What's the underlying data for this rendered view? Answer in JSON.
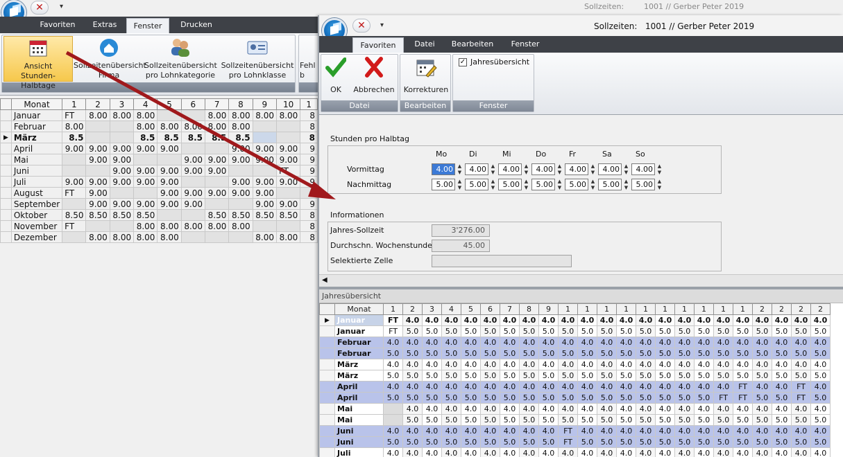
{
  "bg_window": {
    "title_label": "Sollzeiten:",
    "title_value": "1001 // Gerber Peter 2019",
    "tabs": [
      "Favoriten",
      "Extras",
      "Fenster",
      "Drucken"
    ],
    "active_tab": "Fenster",
    "ribbon_buttons": [
      {
        "icon": "calendar-icon",
        "label1": "Ansicht",
        "label2": "Stunden-Halbtage"
      },
      {
        "icon": "home-icon",
        "label1": "Sollzeitenübersicht",
        "label2": "Firma"
      },
      {
        "icon": "users-icon",
        "label1": "Sollzeitenübersicht",
        "label2": "pro Lohnkategorie"
      },
      {
        "icon": "id-card-icon",
        "label1": "Sollzeitenübersicht",
        "label2": "pro Lohnklasse"
      },
      {
        "icon": "cut-icon",
        "label1": "Fehl",
        "label2": "b"
      }
    ],
    "grid": {
      "headers": [
        "Monat",
        "1",
        "2",
        "3",
        "4",
        "5",
        "6",
        "7",
        "8",
        "9",
        "10",
        "1"
      ],
      "rows": [
        {
          "month": "Januar",
          "cells": [
            "FT",
            "8.00",
            "8.00",
            "8.00",
            "",
            "",
            "8.00",
            "8.00",
            "8.00",
            "8.00",
            "8"
          ]
        },
        {
          "month": "Februar",
          "cells": [
            "8.00",
            "",
            "",
            "8.00",
            "8.00",
            "8.00",
            "8.00",
            "8.00",
            "",
            "",
            "8"
          ]
        },
        {
          "month": "März",
          "cells": [
            "8.5",
            "",
            "",
            "8.5",
            "8.5",
            "8.5",
            "8.5",
            "8.5",
            "",
            "",
            "8"
          ]
        },
        {
          "month": "April",
          "cells": [
            "9.00",
            "9.00",
            "9.00",
            "9.00",
            "9.00",
            "",
            "",
            "9.00",
            "9.00",
            "9.00",
            "9"
          ]
        },
        {
          "month": "Mai",
          "cells": [
            "",
            "9.00",
            "9.00",
            "",
            "",
            "9.00",
            "9.00",
            "9.00",
            "9.00",
            "9.00",
            "9"
          ]
        },
        {
          "month": "Juni",
          "cells": [
            "",
            "",
            "9.00",
            "9.00",
            "9.00",
            "9.00",
            "9.00",
            "",
            "",
            "FT",
            "9"
          ]
        },
        {
          "month": "Juli",
          "cells": [
            "9.00",
            "9.00",
            "9.00",
            "9.00",
            "9.00",
            "",
            "",
            "9.00",
            "9.00",
            "9.00",
            "9"
          ]
        },
        {
          "month": "August",
          "cells": [
            "FT",
            "9.00",
            "",
            "",
            "9.00",
            "9.00",
            "9.00",
            "9.00",
            "9.00",
            "",
            ""
          ]
        },
        {
          "month": "September",
          "cells": [
            "",
            "9.00",
            "9.00",
            "9.00",
            "9.00",
            "9.00",
            "",
            "",
            "9.00",
            "9.00",
            "9"
          ]
        },
        {
          "month": "Oktober",
          "cells": [
            "8.50",
            "8.50",
            "8.50",
            "8.50",
            "",
            "",
            "8.50",
            "8.50",
            "8.50",
            "8.50",
            "8"
          ]
        },
        {
          "month": "November",
          "cells": [
            "FT",
            "",
            "",
            "8.00",
            "8.00",
            "8.00",
            "8.00",
            "8.00",
            "",
            "",
            "8"
          ]
        },
        {
          "month": "Dezember",
          "cells": [
            "",
            "8.00",
            "8.00",
            "8.00",
            "8.00",
            "",
            "",
            "",
            "8.00",
            "8.00",
            "8"
          ]
        }
      ]
    }
  },
  "fg_window": {
    "title_label": "Sollzeiten:",
    "title_value": "1001 // Gerber Peter 2019",
    "tabs": [
      "Favoriten",
      "Datei",
      "Bearbeiten",
      "Fenster"
    ],
    "active_tab": "Favoriten",
    "ribbon": {
      "ok": "OK",
      "cancel": "Abbrechen",
      "corrections": "Korrekturen",
      "year_overview_checkbox": "Jahresübersicht",
      "group_datei": "Datei",
      "group_bearbeiten": "Bearbeiten",
      "group_fenster": "Fenster"
    },
    "hours": {
      "title": "Stunden pro Halbtag",
      "days": [
        "Mo",
        "Di",
        "Mi",
        "Do",
        "Fr",
        "Sa",
        "So"
      ],
      "morning_label": "Vormittag",
      "afternoon_label": "Nachmittag",
      "morning": [
        "4.00",
        "4.00",
        "4.00",
        "4.00",
        "4.00",
        "4.00",
        "4.00"
      ],
      "afternoon": [
        "5.00",
        "5.00",
        "5.00",
        "5.00",
        "5.00",
        "5.00",
        "5.00"
      ]
    },
    "info": {
      "title": "Informationen",
      "annual_label": "Jahres-Sollzeit",
      "annual_value": "3'276.00",
      "weekly_label": "Durchschn. Wochenstunden",
      "weekly_value": "45.00",
      "selected_label": "Selektierte Zelle",
      "selected_value": ""
    },
    "overview": {
      "title": "Jahresübersicht",
      "month_header": "Monat",
      "col_headers": [
        "1",
        "2",
        "3",
        "4",
        "5",
        "6",
        "7",
        "8",
        "9",
        "1",
        "1",
        "1",
        "1",
        "1",
        "1",
        "1",
        "1",
        "1",
        "1",
        "2",
        "2",
        "2",
        "2"
      ],
      "rows": [
        {
          "month": "Januar",
          "blue": false,
          "hdr": true,
          "cells": [
            "FT",
            "4.0",
            "4.0",
            "4.0",
            "4.0",
            "4.0",
            "4.0",
            "4.0",
            "4.0",
            "4.0",
            "4.0",
            "4.0",
            "4.0",
            "4.0",
            "4.0",
            "4.0",
            "4.0",
            "4.0",
            "4.0",
            "4.0",
            "4.0",
            "4.0",
            "4.0"
          ]
        },
        {
          "month": "Januar",
          "blue": false,
          "hdr": false,
          "cells": [
            "FT",
            "5.0",
            "5.0",
            "5.0",
            "5.0",
            "5.0",
            "5.0",
            "5.0",
            "5.0",
            "5.0",
            "5.0",
            "5.0",
            "5.0",
            "5.0",
            "5.0",
            "5.0",
            "5.0",
            "5.0",
            "5.0",
            "5.0",
            "5.0",
            "5.0",
            "5.0"
          ]
        },
        {
          "month": "Februar",
          "blue": true,
          "hdr": false,
          "cells": [
            "4.0",
            "4.0",
            "4.0",
            "4.0",
            "4.0",
            "4.0",
            "4.0",
            "4.0",
            "4.0",
            "4.0",
            "4.0",
            "4.0",
            "4.0",
            "4.0",
            "4.0",
            "4.0",
            "4.0",
            "4.0",
            "4.0",
            "4.0",
            "4.0",
            "4.0",
            "4.0"
          ]
        },
        {
          "month": "Februar",
          "blue": true,
          "hdr": false,
          "cells": [
            "5.0",
            "5.0",
            "5.0",
            "5.0",
            "5.0",
            "5.0",
            "5.0",
            "5.0",
            "5.0",
            "5.0",
            "5.0",
            "5.0",
            "5.0",
            "5.0",
            "5.0",
            "5.0",
            "5.0",
            "5.0",
            "5.0",
            "5.0",
            "5.0",
            "5.0",
            "5.0"
          ]
        },
        {
          "month": "März",
          "blue": false,
          "hdr": false,
          "cells": [
            "4.0",
            "4.0",
            "4.0",
            "4.0",
            "4.0",
            "4.0",
            "4.0",
            "4.0",
            "4.0",
            "4.0",
            "4.0",
            "4.0",
            "4.0",
            "4.0",
            "4.0",
            "4.0",
            "4.0",
            "4.0",
            "4.0",
            "4.0",
            "4.0",
            "4.0",
            "4.0"
          ]
        },
        {
          "month": "März",
          "blue": false,
          "hdr": false,
          "cells": [
            "5.0",
            "5.0",
            "5.0",
            "5.0",
            "5.0",
            "5.0",
            "5.0",
            "5.0",
            "5.0",
            "5.0",
            "5.0",
            "5.0",
            "5.0",
            "5.0",
            "5.0",
            "5.0",
            "5.0",
            "5.0",
            "5.0",
            "5.0",
            "5.0",
            "5.0",
            "5.0"
          ]
        },
        {
          "month": "April",
          "blue": true,
          "hdr": false,
          "cells": [
            "4.0",
            "4.0",
            "4.0",
            "4.0",
            "4.0",
            "4.0",
            "4.0",
            "4.0",
            "4.0",
            "4.0",
            "4.0",
            "4.0",
            "4.0",
            "4.0",
            "4.0",
            "4.0",
            "4.0",
            "4.0",
            "FT",
            "4.0",
            "4.0",
            "FT",
            "4.0"
          ]
        },
        {
          "month": "April",
          "blue": true,
          "hdr": false,
          "cells": [
            "5.0",
            "5.0",
            "5.0",
            "5.0",
            "5.0",
            "5.0",
            "5.0",
            "5.0",
            "5.0",
            "5.0",
            "5.0",
            "5.0",
            "5.0",
            "5.0",
            "5.0",
            "5.0",
            "5.0",
            "FT",
            "FT",
            "5.0",
            "5.0",
            "FT",
            "5.0"
          ]
        },
        {
          "month": "Mai",
          "blue": false,
          "hdr": false,
          "cells": [
            "",
            "4.0",
            "4.0",
            "4.0",
            "4.0",
            "4.0",
            "4.0",
            "4.0",
            "4.0",
            "4.0",
            "4.0",
            "4.0",
            "4.0",
            "4.0",
            "4.0",
            "4.0",
            "4.0",
            "4.0",
            "4.0",
            "4.0",
            "4.0",
            "4.0",
            "4.0"
          ]
        },
        {
          "month": "Mai",
          "blue": false,
          "hdr": false,
          "cells": [
            "",
            "5.0",
            "5.0",
            "5.0",
            "5.0",
            "5.0",
            "5.0",
            "5.0",
            "5.0",
            "5.0",
            "5.0",
            "5.0",
            "5.0",
            "5.0",
            "5.0",
            "5.0",
            "5.0",
            "5.0",
            "5.0",
            "5.0",
            "5.0",
            "5.0",
            "5.0"
          ]
        },
        {
          "month": "Juni",
          "blue": true,
          "hdr": false,
          "cells": [
            "4.0",
            "4.0",
            "4.0",
            "4.0",
            "4.0",
            "4.0",
            "4.0",
            "4.0",
            "4.0",
            "FT",
            "4.0",
            "4.0",
            "4.0",
            "4.0",
            "4.0",
            "4.0",
            "4.0",
            "4.0",
            "4.0",
            "4.0",
            "4.0",
            "4.0",
            "4.0"
          ]
        },
        {
          "month": "Juni",
          "blue": true,
          "hdr": false,
          "cells": [
            "5.0",
            "5.0",
            "5.0",
            "5.0",
            "5.0",
            "5.0",
            "5.0",
            "5.0",
            "5.0",
            "FT",
            "5.0",
            "5.0",
            "5.0",
            "5.0",
            "5.0",
            "5.0",
            "5.0",
            "5.0",
            "5.0",
            "5.0",
            "5.0",
            "5.0",
            "5.0"
          ]
        },
        {
          "month": "Juli",
          "blue": false,
          "hdr": false,
          "cells": [
            "4.0",
            "4.0",
            "4.0",
            "4.0",
            "4.0",
            "4.0",
            "4.0",
            "4.0",
            "4.0",
            "4.0",
            "4.0",
            "4.0",
            "4.0",
            "4.0",
            "4.0",
            "4.0",
            "4.0",
            "4.0",
            "4.0",
            "4.0",
            "4.0",
            "4.0",
            "4.0"
          ]
        }
      ]
    }
  },
  "annotation": {
    "color": "#a0191c"
  }
}
